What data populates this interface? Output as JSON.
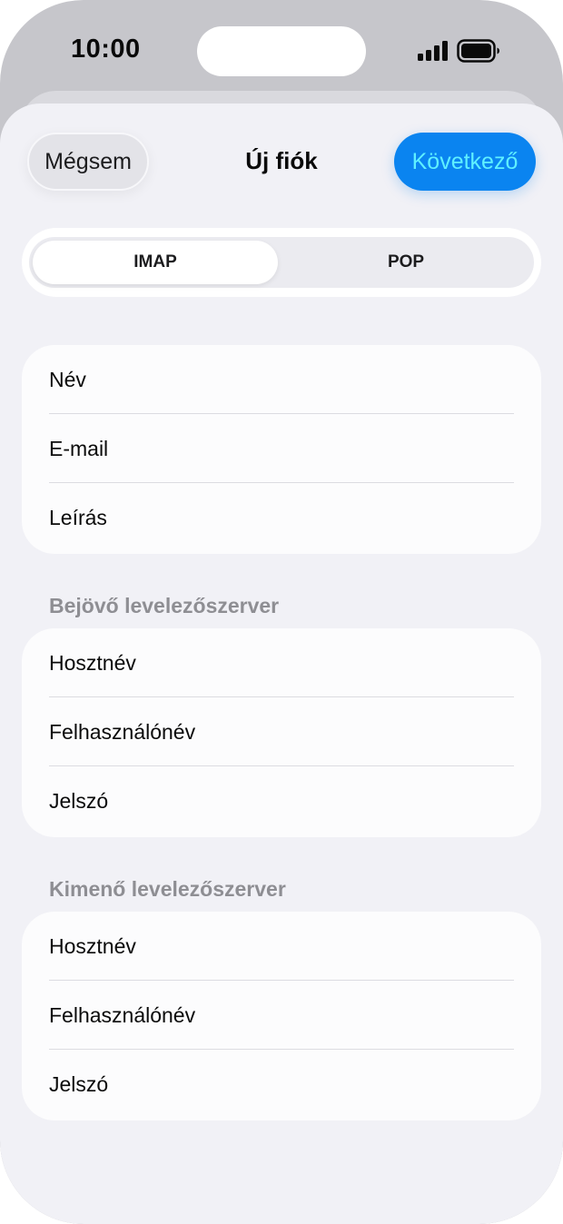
{
  "status_bar": {
    "time": "10:00",
    "signal_icon": "cellular-signal-icon",
    "battery_icon": "battery-full-icon"
  },
  "nav": {
    "cancel_label": "Mégsem",
    "title": "Új fiók",
    "next_label": "Következő"
  },
  "segment": {
    "options": [
      "IMAP",
      "POP"
    ],
    "selected": "IMAP"
  },
  "account_fields": [
    "Név",
    "E-mail",
    "Leírás"
  ],
  "incoming": {
    "header": "Bejövő levelezőszerver",
    "fields": [
      "Hosztnév",
      "Felhasználónév",
      "Jelszó"
    ]
  },
  "outgoing": {
    "header": "Kimenő levelezőszerver",
    "fields": [
      "Hosztnév",
      "Felhasználónév",
      "Jelszó"
    ]
  },
  "colors": {
    "accent": "#0a84f0",
    "next_text": "#5ff0ff",
    "section_header": "#8e8e93",
    "sheet_background": "#f1f1f6"
  }
}
